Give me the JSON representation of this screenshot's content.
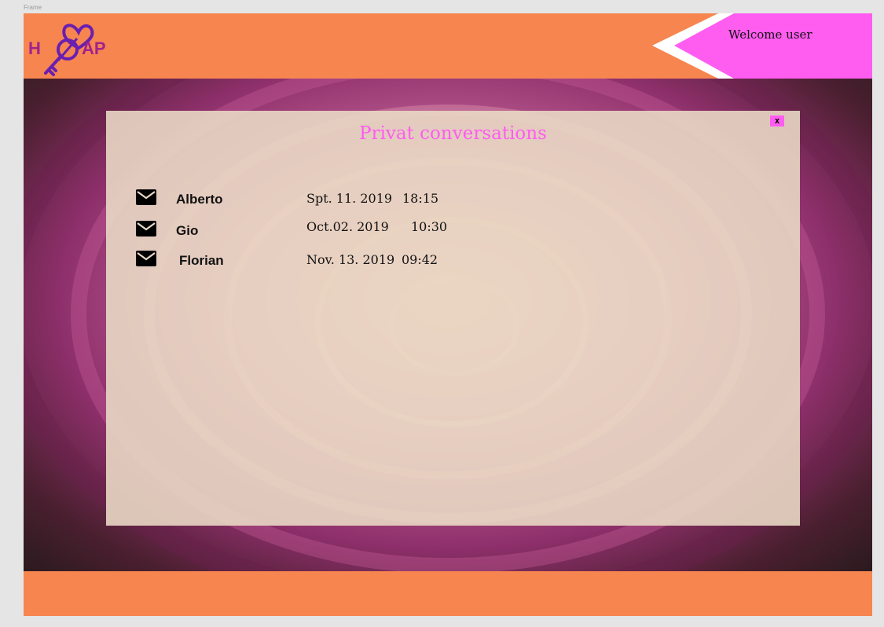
{
  "canvas": {
    "frame_label": "Frame"
  },
  "header": {
    "logo": {
      "letters_left": "H",
      "letters_right": "AP",
      "icon": "heart-key-icon"
    },
    "welcome_text": "Welcome user"
  },
  "panel": {
    "title": "Privat conversations",
    "close_label": "x",
    "conversations": [
      {
        "name": "Alberto",
        "date": "Spt. 11. 2019",
        "time": "18:15",
        "icon": "envelope-icon"
      },
      {
        "name": "Gio",
        "date": "Oct.02. 2019",
        "time": "10:30",
        "icon": "envelope-icon"
      },
      {
        "name": "Florian",
        "date": "Nov. 13. 2019",
        "time": "09:42",
        "icon": "envelope-icon"
      }
    ]
  },
  "colors": {
    "orange": "#f68550",
    "pink": "#ff5cf0",
    "logo_purple": "#6a1fb0",
    "logo_text": "#a0238c",
    "panel_bg": "#e9d8c4"
  }
}
